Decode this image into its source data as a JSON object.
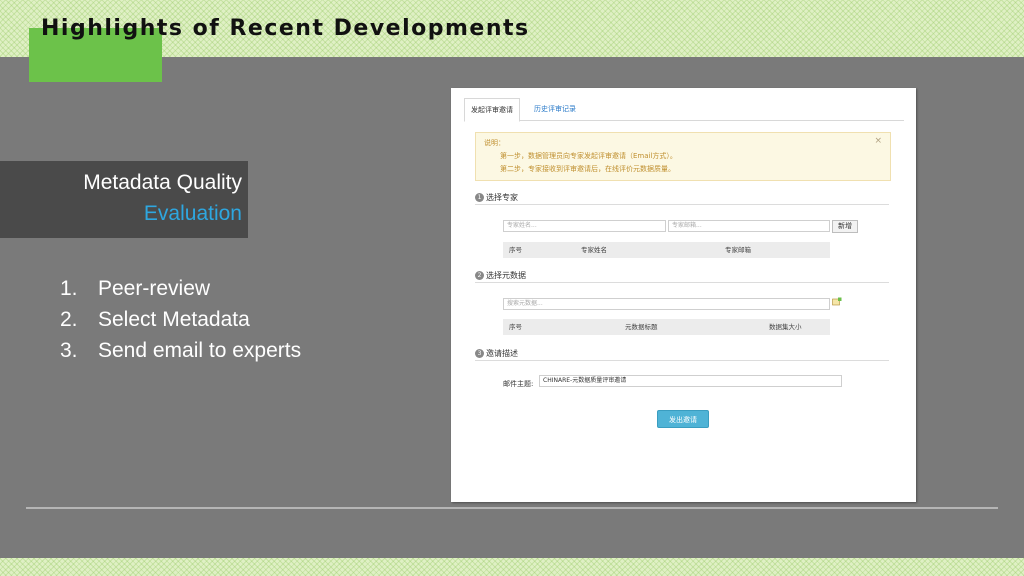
{
  "slide": {
    "title": "Highlights of Recent Developments",
    "heading_line1": "Metadata Quality",
    "heading_line2": "Evaluation",
    "steps": [
      {
        "num": "1.",
        "text": "Peer-review"
      },
      {
        "num": "2.",
        "text": "Select Metadata"
      },
      {
        "num": "3.",
        "text": "Send email to experts"
      }
    ],
    "colors": {
      "accent_green": "#6cc24a",
      "heading_blue": "#2ea7e0",
      "background": "#7a7a7a"
    }
  },
  "screenshot": {
    "tabs": [
      "发起评审邀请",
      "历史评审记录"
    ],
    "notice": {
      "title": "说明：",
      "step1": "第一步，数据管理员向专家发起评审邀请（Email方式）。",
      "step2": "第二步，专家接收到评审邀请后，在线评价元数据质量。",
      "close": "×"
    },
    "section1": {
      "num": "1",
      "title": "选择专家",
      "name_placeholder": "专家姓名...",
      "email_placeholder": "专家邮箱...",
      "add_button": "新增",
      "columns": [
        "序号",
        "专家姓名",
        "专家邮箱"
      ]
    },
    "section2": {
      "num": "2",
      "title": "选择元数据",
      "search_placeholder": "搜索元数据...",
      "columns": [
        "序号",
        "元数据标题",
        "数据集大小"
      ]
    },
    "section3": {
      "num": "3",
      "title": "邀请描述",
      "subject_label": "邮件主题:",
      "subject_value": "CHINARE-元数据质量评审邀请"
    },
    "send_button": "发出邀请"
  }
}
